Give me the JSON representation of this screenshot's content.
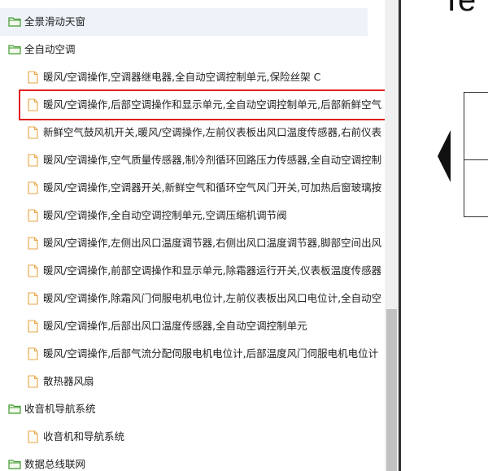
{
  "tree": {
    "rows": [
      {
        "type": "folder",
        "label": "全景滑动天窗",
        "highlight": true
      },
      {
        "type": "folder",
        "label": "全自动空调",
        "highlight": false
      },
      {
        "type": "file",
        "label": "暖风/空调操作,空调器继电器,全自动空调控制单元,保险丝架 C"
      },
      {
        "type": "file",
        "label": "暖风/空调操作,后部空调操作和显示单元,全自动空调控制单元,后部新鲜空气",
        "selected": true
      },
      {
        "type": "file",
        "label": "新鲜空气鼓风机开关,暖风/空调操作,左前仪表板出风口温度传感器,右前仪表"
      },
      {
        "type": "file",
        "label": "暖风/空调操作,空气质量传感器,制冷剂循环回路压力传感器,全自动空调控制"
      },
      {
        "type": "file",
        "label": "暖风/空调操作,空调器开关,新鲜空气和循环空气风门开关,可加热后窗玻璃按"
      },
      {
        "type": "file",
        "label": "暖风/空调操作,全自动空调控制单元,空调压缩机调节阀"
      },
      {
        "type": "file",
        "label": "暖风/空调操作,左侧出风口温度调节器,右侧出风口温度调节器,脚部空间出风"
      },
      {
        "type": "file",
        "label": "暖风/空调操作,前部空调操作和显示单元,除霜器运行开关,仪表板温度传感器"
      },
      {
        "type": "file",
        "label": "暖风/空调操作,除霜风门伺服电机电位计,左前仪表板出风口电位计,全自动空"
      },
      {
        "type": "file",
        "label": "暖风/空调操作,后部出风口温度传感器,全自动空调控制单元"
      },
      {
        "type": "file",
        "label": "暖风/空调操作,后部气流分配伺服电机电位计,后部温度风门伺服电机电位计"
      },
      {
        "type": "file",
        "label": "散热器风扇"
      },
      {
        "type": "folder",
        "label": "收音机导航系统",
        "highlight": false
      },
      {
        "type": "file",
        "label": "收音机和导航系统"
      },
      {
        "type": "folder",
        "label": "数据总线联网",
        "highlight": false
      }
    ]
  },
  "doc": {
    "title_fragment": "Te"
  },
  "colors": {
    "folder_fill": "#f3f9ec",
    "folder_stroke": "#3f9b2f",
    "file_stroke": "#e8a64a",
    "selection_border": "#e02020"
  },
  "icons": {
    "folder": "folder-icon",
    "file": "file-icon",
    "prev": "arrow-left-icon"
  }
}
